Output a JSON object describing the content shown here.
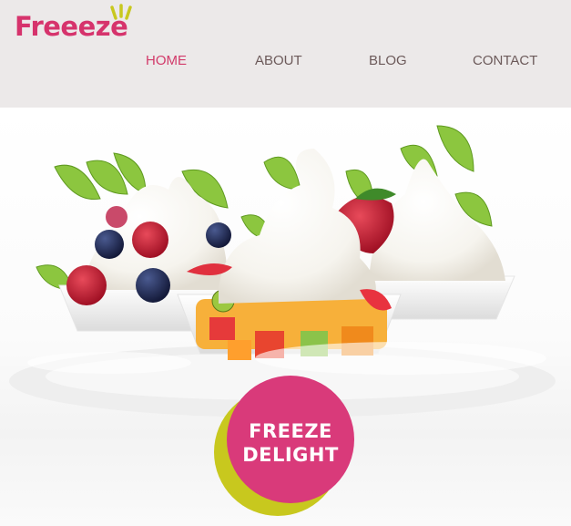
{
  "brand": {
    "name": "Freeeze",
    "primary": "#d6336c",
    "accent": "#c8c81e"
  },
  "nav": {
    "items": [
      {
        "label": "HOME",
        "active": true
      },
      {
        "label": "ABOUT",
        "active": false
      },
      {
        "label": "BLOG",
        "active": false
      },
      {
        "label": "CONTACT",
        "active": false
      }
    ]
  },
  "hero": {
    "image": "frozen-yogurt-cups-with-berries-and-fruit",
    "badge": {
      "line1": "FREEZE",
      "line2": "DELIGHT",
      "color": "#d93a7a"
    }
  }
}
